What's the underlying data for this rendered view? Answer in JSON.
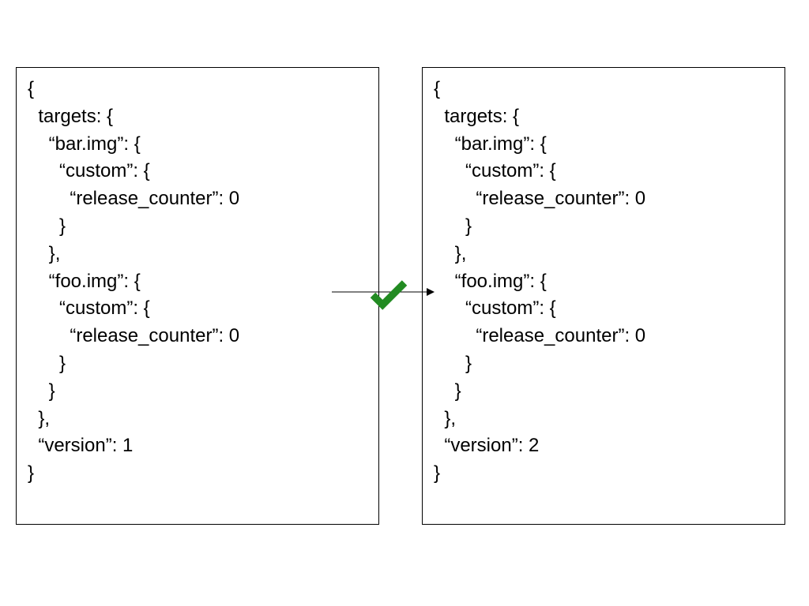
{
  "left": {
    "lines": [
      "{",
      "  targets: {",
      "    “bar.img”: {",
      "      “custom”: {",
      "        “release_counter”: 0",
      "      }",
      "    },",
      "    “foo.img”: {",
      "      “custom”: {",
      "        “release_counter”: 0",
      "      }",
      "    }",
      "  },",
      "  “version”: 1",
      "}"
    ]
  },
  "right": {
    "lines": [
      "{",
      "  targets: {",
      "    “bar.img”: {",
      "      “custom”: {",
      "        “release_counter”: 0",
      "      }",
      "    },",
      "    “foo.img”: {",
      "      “custom”: {",
      "        “release_counter”: 0",
      "      }",
      "    }",
      "  },",
      "  “version”: 2",
      "}"
    ]
  },
  "colors": {
    "check": "#228B22"
  }
}
